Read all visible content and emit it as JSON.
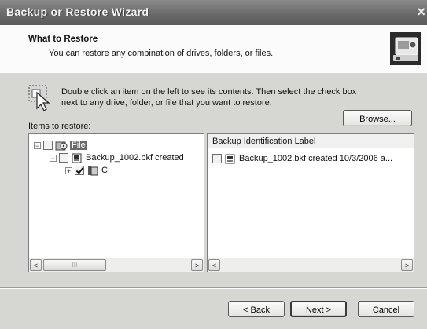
{
  "window": {
    "title": "Backup or Restore Wizard",
    "close_label": "×"
  },
  "header": {
    "title": "What to Restore",
    "subtitle": "You can restore any combination of drives, folders, or files.",
    "image_icon": "backup-restore-icon"
  },
  "instructions": {
    "icon": "double-click-icon",
    "text": "Double click an item on the left to see its contents. Then select the check box next to any drive, folder, or file that you want to restore."
  },
  "items_label": "Items to restore:",
  "browse_label": "Browse...",
  "tree": [
    {
      "label": "File",
      "expander": "−",
      "checked": false,
      "icon": "file-backup-icon",
      "selected": true
    },
    {
      "label": "Backup_1002.bkf created",
      "expander": "−",
      "checked": false,
      "icon": "backup-file-icon",
      "selected": false
    },
    {
      "label": "C:",
      "expander": "+",
      "checked": true,
      "icon": "drive-icon",
      "selected": false
    }
  ],
  "right_pane": {
    "column_header": "Backup Identification Label",
    "rows": [
      {
        "label": "Backup_1002.bkf created 10/3/2006 a...",
        "checked": false,
        "icon": "backup-file-icon"
      }
    ]
  },
  "scroll": {
    "left_arrow": "<",
    "right_arrow": ">",
    "thumb_grip": "III"
  },
  "buttons": {
    "back": "< Back",
    "next": "Next >",
    "cancel": "Cancel"
  }
}
